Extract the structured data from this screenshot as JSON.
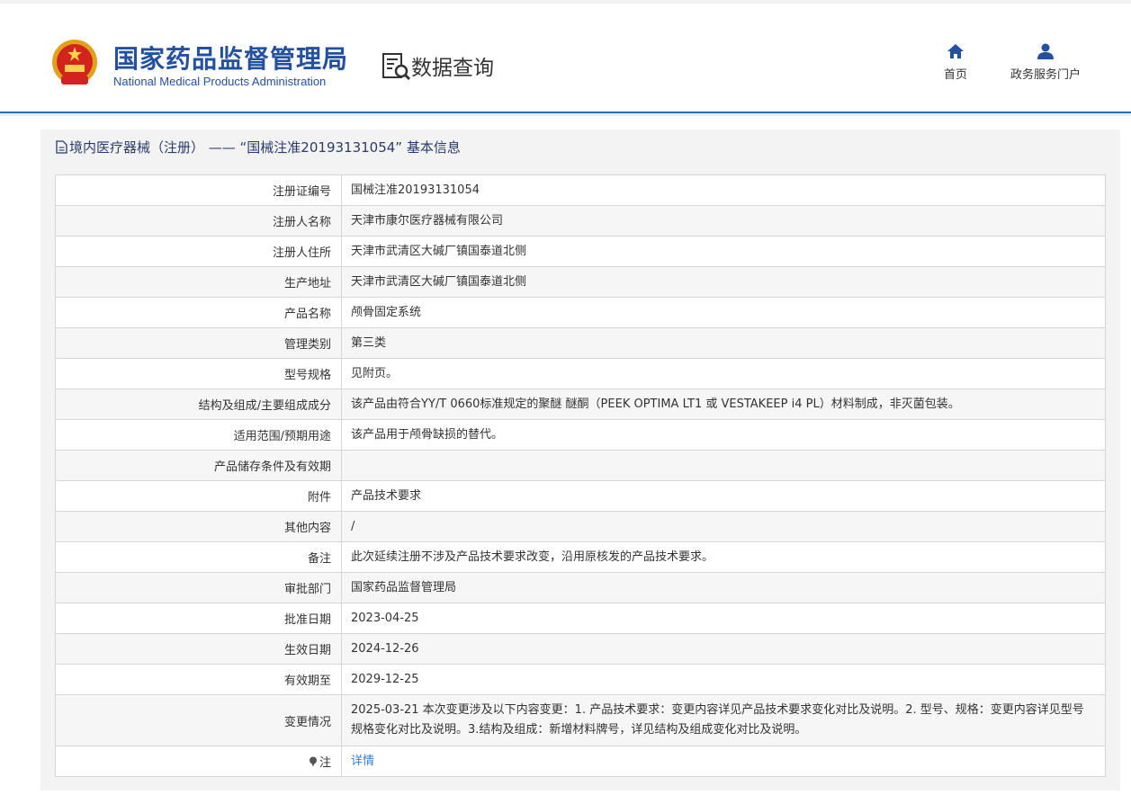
{
  "header": {
    "brand_cn": "国家药品监督管理局",
    "brand_en": "National Medical Products Administration",
    "section": "数据查询",
    "nav": [
      {
        "label": "首页",
        "icon": "home-icon"
      },
      {
        "label": "政务服务门户",
        "icon": "user-icon"
      }
    ]
  },
  "panel": {
    "title": "境内医疗器械（注册） —— “国械注准20193131054” 基本信息"
  },
  "colors": {
    "brand_blue": "#2350a0",
    "link_blue": "#3a7bd5",
    "rule_blue": "#2b6cb8"
  },
  "rows": [
    {
      "label": "注册证编号",
      "value": "国械注准20193131054"
    },
    {
      "label": "注册人名称",
      "value": "天津市康尔医疗器械有限公司"
    },
    {
      "label": "注册人住所",
      "value": "天津市武清区大碱厂镇国泰道北侧"
    },
    {
      "label": "生产地址",
      "value": "天津市武清区大碱厂镇国泰道北侧"
    },
    {
      "label": "产品名称",
      "value": "颅骨固定系统"
    },
    {
      "label": "管理类别",
      "value": "第三类"
    },
    {
      "label": "型号规格",
      "value": "见附页。"
    },
    {
      "label": "结构及组成/主要组成成分",
      "value": "该产品由符合YY/T 0660标准规定的聚醚 醚酮（PEEK OPTIMA LT1 或 VESTAKEEP i4 PL）材料制成，非灭菌包装。"
    },
    {
      "label": "适用范围/预期用途",
      "value": "该产品用于颅骨缺损的替代。"
    },
    {
      "label": "产品储存条件及有效期",
      "value": ""
    },
    {
      "label": "附件",
      "value": "产品技术要求"
    },
    {
      "label": "其他内容",
      "value": "/"
    },
    {
      "label": "备注",
      "value": "此次延续注册不涉及产品技术要求改变，沿用原核发的产品技术要求。"
    },
    {
      "label": "审批部门",
      "value": "国家药品监督管理局"
    },
    {
      "label": "批准日期",
      "value": "2023-04-25"
    },
    {
      "label": "生效日期",
      "value": "2024-12-26"
    },
    {
      "label": "有效期至",
      "value": "2029-12-25"
    },
    {
      "label": "变更情况",
      "value": "2025-03-21 本次变更涉及以下内容变更：1. 产品技术要求：变更内容详见产品技术要求变化对比及说明。2. 型号、规格：变更内容详见型号规格变化对比及说明。3.结构及组成：新增材料牌号，详见结构及组成变化对比及说明。"
    },
    {
      "label": "注",
      "value": "详情",
      "icon": "pin-icon"
    }
  ]
}
